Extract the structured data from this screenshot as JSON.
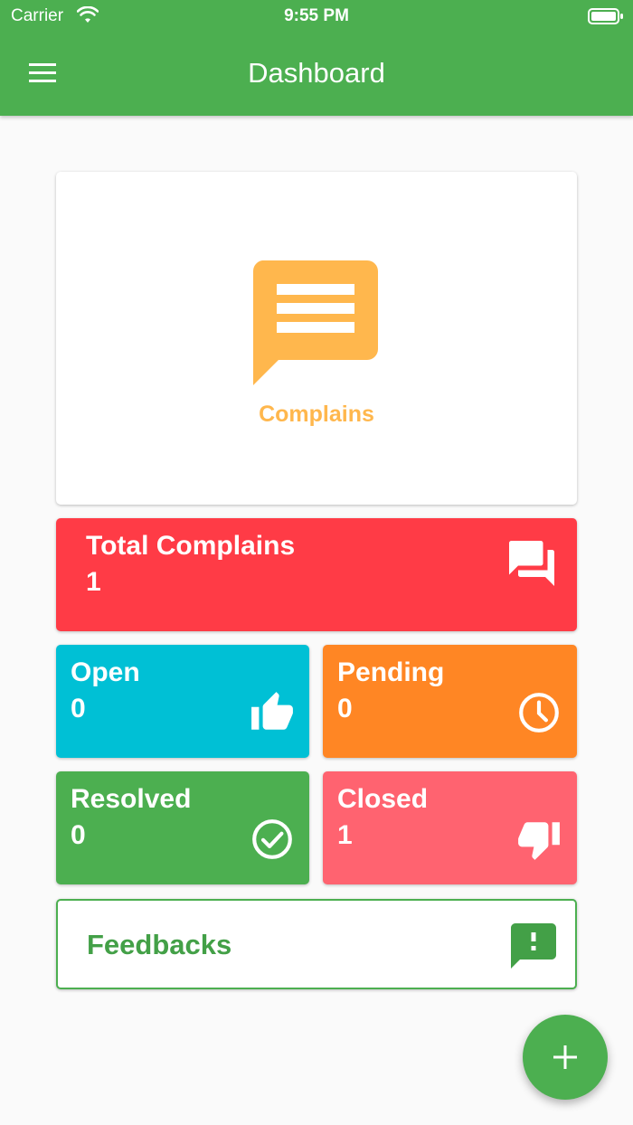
{
  "status_bar": {
    "carrier": "Carrier",
    "time": "9:55 PM"
  },
  "app_bar": {
    "title": "Dashboard"
  },
  "hero": {
    "label": "Complains",
    "icon": "chat-text-icon",
    "color": "#ffb74d"
  },
  "stats": {
    "total": {
      "label": "Total Complains",
      "value": "1",
      "icon": "forum-icon",
      "color": "#ff3b46"
    },
    "open": {
      "label": "Open",
      "value": "0",
      "icon": "thumb-up-icon",
      "color": "#00c0d5"
    },
    "pending": {
      "label": "Pending",
      "value": "0",
      "icon": "clock-icon",
      "color": "#ff8624"
    },
    "resolved": {
      "label": "Resolved",
      "value": "0",
      "icon": "check-circle-icon",
      "color": "#4caf50"
    },
    "closed": {
      "label": "Closed",
      "value": "1",
      "icon": "thumb-down-icon",
      "color": "#ff6370"
    }
  },
  "feedback": {
    "label": "Feedbacks",
    "icon": "feedback-icon",
    "color": "#43a047"
  },
  "fab": {
    "icon": "plus-icon"
  },
  "colors": {
    "primary": "#4caf50",
    "background": "#fafafa"
  }
}
